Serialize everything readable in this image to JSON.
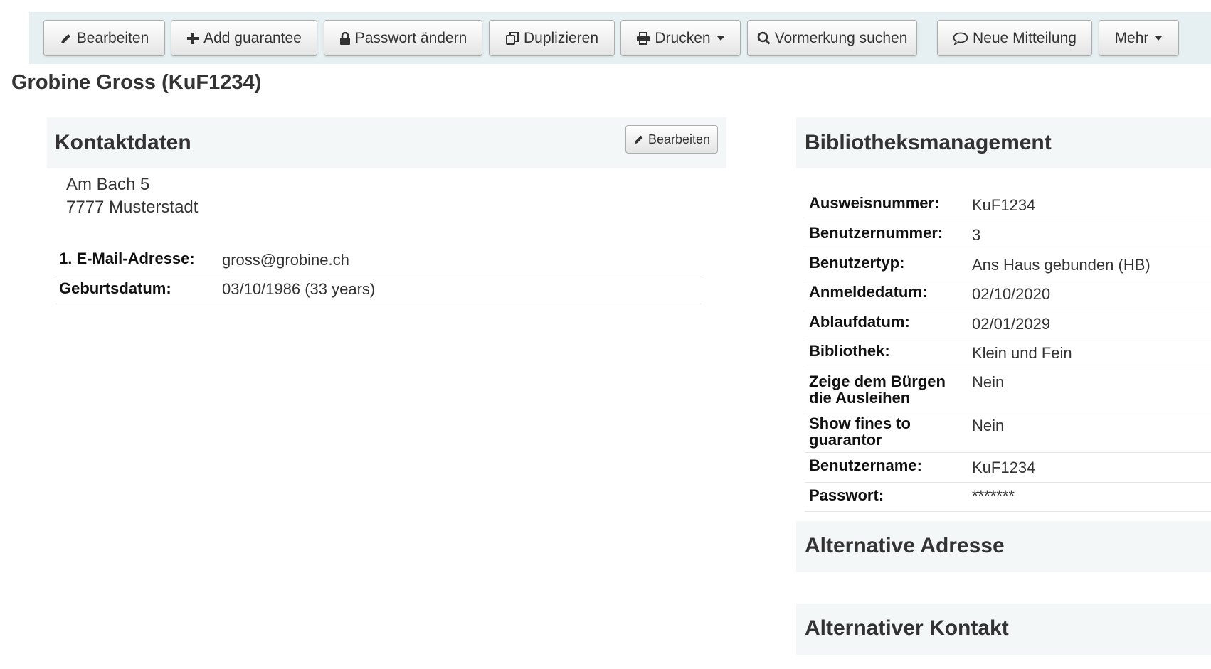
{
  "toolbar": {
    "edit": "Bearbeiten",
    "add_guarantee": "Add guarantee",
    "change_password": "Passwort ändern",
    "duplicate": "Duplizieren",
    "print": "Drucken",
    "search_hold": "Vormerkung suchen",
    "new_message": "Neue Mitteilung",
    "more": "Mehr"
  },
  "patron": {
    "title": "Grobine Gross (KuF1234)"
  },
  "contact": {
    "heading": "Kontaktdaten",
    "edit_label": "Bearbeiten",
    "address_line1": "Am Bach 5",
    "address_line2": "7777 Musterstadt",
    "rows": [
      {
        "label": "1. E-Mail-Adresse:",
        "value": "gross@grobine.ch"
      },
      {
        "label": "Geburtsdatum:",
        "value": "03/10/1986 (33 years)"
      }
    ]
  },
  "library": {
    "heading": "Bibliotheksmanagement",
    "rows": [
      {
        "label": "Ausweisnummer:",
        "value": "KuF1234"
      },
      {
        "label": "Benutzernummer:",
        "value": "3"
      },
      {
        "label": "Benutzertyp:",
        "value": "Ans Haus gebunden (HB)"
      },
      {
        "label": "Anmeldedatum:",
        "value": "02/10/2020"
      },
      {
        "label": "Ablaufdatum:",
        "value": "02/01/2029"
      },
      {
        "label": "Bibliothek:",
        "value": "Klein und Fein"
      },
      {
        "label": "Zeige dem Bürgen die Ausleihen",
        "value": "Nein"
      },
      {
        "label": "Show fines to guarantor",
        "value": "Nein"
      },
      {
        "label": "Benutzername:",
        "value": "KuF1234"
      },
      {
        "label": "Passwort:",
        "value": "*******"
      }
    ]
  },
  "alt_address": {
    "heading": "Alternative Adresse"
  },
  "alt_contact": {
    "heading": "Alternativer Kontakt"
  },
  "colors": {
    "toolbar_bg": "#e6f0f2",
    "panel_bg": "#f3f7f8",
    "link": "#004d99"
  }
}
